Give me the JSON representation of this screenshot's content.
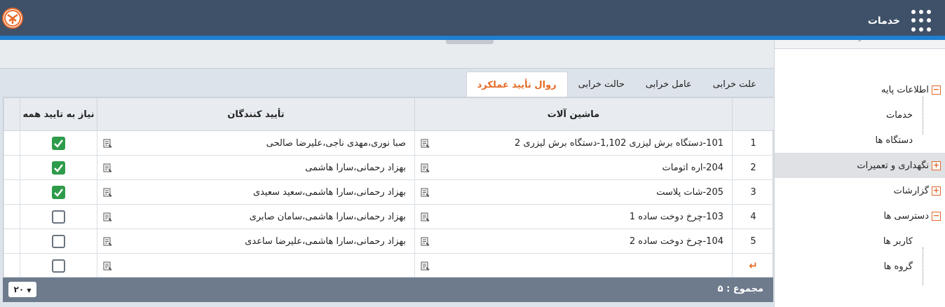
{
  "header": {
    "brand_label": "خدمات",
    "logo_icon": "app-logo-icon",
    "menu_icon": "apps-grid-icon"
  },
  "colors": {
    "topbar": "#3f5168",
    "accent_line": "#1f7fd0",
    "orange": "#e46a24",
    "check_green": "#2e9b4a"
  },
  "sidebar": {
    "items": [
      {
        "label": "اطلاعات پایه",
        "toggle": "−",
        "level": 0
      },
      {
        "label": "خدمات",
        "level": 1
      },
      {
        "label": "دستگاه ها",
        "level": 1
      },
      {
        "label": "نگهداری و تعمیرات",
        "toggle": "+",
        "level": 0,
        "active": true
      },
      {
        "label": "گزارشات",
        "toggle": "+",
        "level": 0
      },
      {
        "label": "دسترسی ها",
        "toggle": "−",
        "level": 0
      },
      {
        "label": "کاربر ها",
        "level": 1
      },
      {
        "label": "گروه ها",
        "level": 1
      }
    ]
  },
  "tabs": [
    {
      "label": "علت خرابی"
    },
    {
      "label": "عامل خرابی"
    },
    {
      "label": "حالت خرابی"
    },
    {
      "label": "روال تأیید عملکرد",
      "active": true
    }
  ],
  "table": {
    "columns": [
      "",
      "ماشین آلات",
      "تأیید کنندگان",
      "نیاز به تایید همه"
    ],
    "rows": [
      {
        "num": "1",
        "machine": "101-دستگاه برش لیزری 1,102-دستگاه برش لیزری 2",
        "approvers": "صبا نوری،مهدی ناجی،علیرضا صالحی",
        "all": true
      },
      {
        "num": "2",
        "machine": "204-اره اتومات",
        "approvers": "بهزاد رحمانی،سارا هاشمی",
        "all": true
      },
      {
        "num": "3",
        "machine": "205-شات پلاست",
        "approvers": "بهزاد رحمانی،سارا هاشمی،سعید سعیدی",
        "all": true
      },
      {
        "num": "4",
        "machine": "103-چرخ دوخت ساده 1",
        "approvers": "بهزاد رحمانی،سارا هاشمی،سامان صابری",
        "all": false
      },
      {
        "num": "5",
        "machine": "104-چرخ دوخت ساده 2",
        "approvers": "بهزاد رحمانی،سارا هاشمی،علیرضا ساعدی",
        "all": false
      }
    ],
    "new_row_icon": "↵"
  },
  "footer": {
    "total_label": "مجموع :  ۵",
    "page_size": "۲۰"
  }
}
